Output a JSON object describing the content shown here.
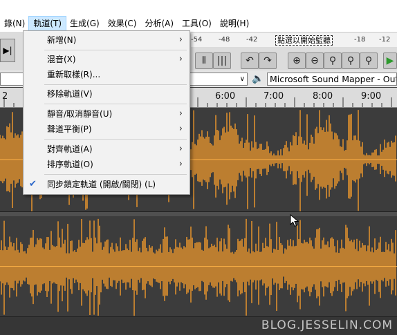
{
  "menubar": {
    "items": [
      "錄(N)",
      "軌道(T)",
      "生成(G)",
      "效果(C)",
      "分析(A)",
      "工具(O)",
      "說明(H)"
    ]
  },
  "meter": {
    "ticks": [
      "-54",
      "-48",
      "-42",
      "-18",
      "-12"
    ],
    "message": "點選以開始監聽"
  },
  "device": {
    "output": "Microsoft Sound Mapper - Output"
  },
  "timeline": {
    "labels": [
      "2",
      "6:00",
      "7:00",
      "8:00",
      "9:00"
    ]
  },
  "track_menu": {
    "items": [
      {
        "label": "新增(N)",
        "submenu": true
      },
      {
        "label": "混音(X)",
        "submenu": true
      },
      {
        "label": "重新取樣(R)...",
        "submenu": false
      },
      {
        "label": "移除軌道(V)",
        "submenu": false
      },
      {
        "label": "靜音/取消靜音(U)",
        "submenu": true
      },
      {
        "label": "聲道平衡(P)",
        "submenu": true
      },
      {
        "label": "對齊軌道(A)",
        "submenu": true
      },
      {
        "label": "排序軌道(O)",
        "submenu": true
      },
      {
        "label": "同步鎖定軌道 (開啟/關閉) (L)",
        "submenu": false,
        "checked": true
      }
    ]
  },
  "watermark": "BLOG.JESSELIN.COM",
  "colors": {
    "waveform": "#f39a2c",
    "track_bg": "#3c3c3c",
    "menu_highlight": "#cce8ff"
  }
}
